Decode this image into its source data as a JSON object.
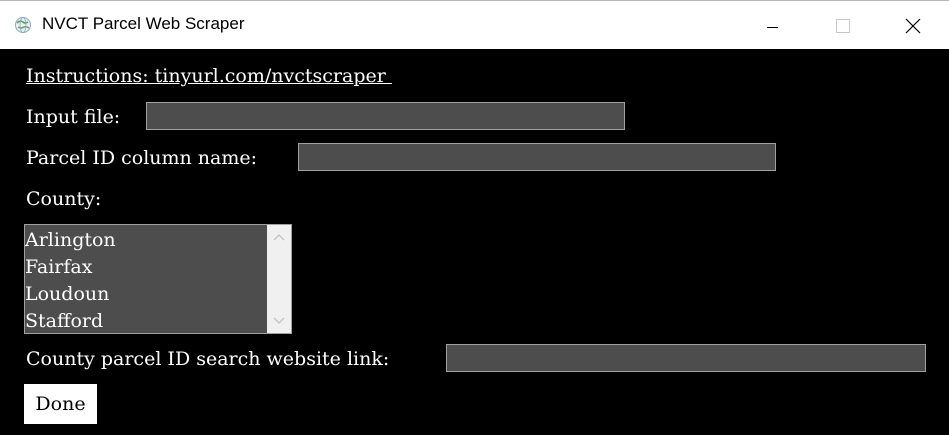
{
  "window": {
    "title": "NVCT Parcel Web Scraper"
  },
  "form": {
    "instructions_link": "Instructions: tinyurl.com/nvctscraper ",
    "input_file_label": "Input file:",
    "input_file_value": "",
    "parcel_id_label": "Parcel ID column name:",
    "parcel_id_value": "",
    "county_label": "County:",
    "county_options": [
      "Arlington",
      "Fairfax",
      "Loudoun",
      "Stafford"
    ],
    "website_link_label": "County parcel ID search website link:",
    "website_link_value": "",
    "done_label": "Done"
  },
  "icons": {
    "app": "globe-app-icon",
    "minimize": "minimize-icon",
    "maximize": "maximize-icon",
    "close": "close-icon",
    "scroll_up": "chevron-up-icon",
    "scroll_down": "chevron-down-icon"
  },
  "colors": {
    "background": "#000000",
    "field": "#4d4d4d",
    "text": "#ffffff",
    "titlebar": "#ffffff"
  }
}
